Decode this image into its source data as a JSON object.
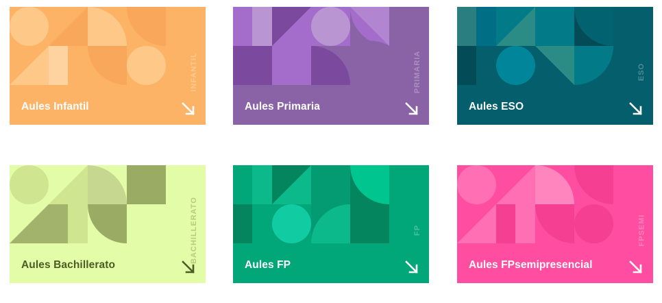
{
  "cards": [
    {
      "label": "Aules Infantil",
      "tag": "INFANTIL",
      "bg": "#fdb365",
      "accent": "#f8a95a",
      "icon": "arrow-down-right-icon"
    },
    {
      "label": "Aules Primaria",
      "tag": "PRIMARIA",
      "bg": "#8a63a7",
      "accent": "#a56dcb",
      "icon": "arrow-down-right-icon"
    },
    {
      "label": "Aules ESO",
      "tag": "ESO",
      "bg": "#045e6b",
      "accent": "#027a87",
      "icon": "arrow-down-right-icon"
    },
    {
      "label": "Aules Bachillerato",
      "tag": "BACHILLERATO",
      "bg": "#e2fca8",
      "accent": "#9aab63",
      "icon": "arrow-down-right-icon"
    },
    {
      "label": "Aules FP",
      "tag": "FP",
      "bg": "#01a679",
      "accent": "#11cca3",
      "icon": "arrow-down-right-icon"
    },
    {
      "label": "Aules FPsemipresencial",
      "tag": "FPSEMI",
      "bg": "#ff4da1",
      "accent": "#ff6fb3",
      "icon": "arrow-down-right-icon"
    }
  ]
}
